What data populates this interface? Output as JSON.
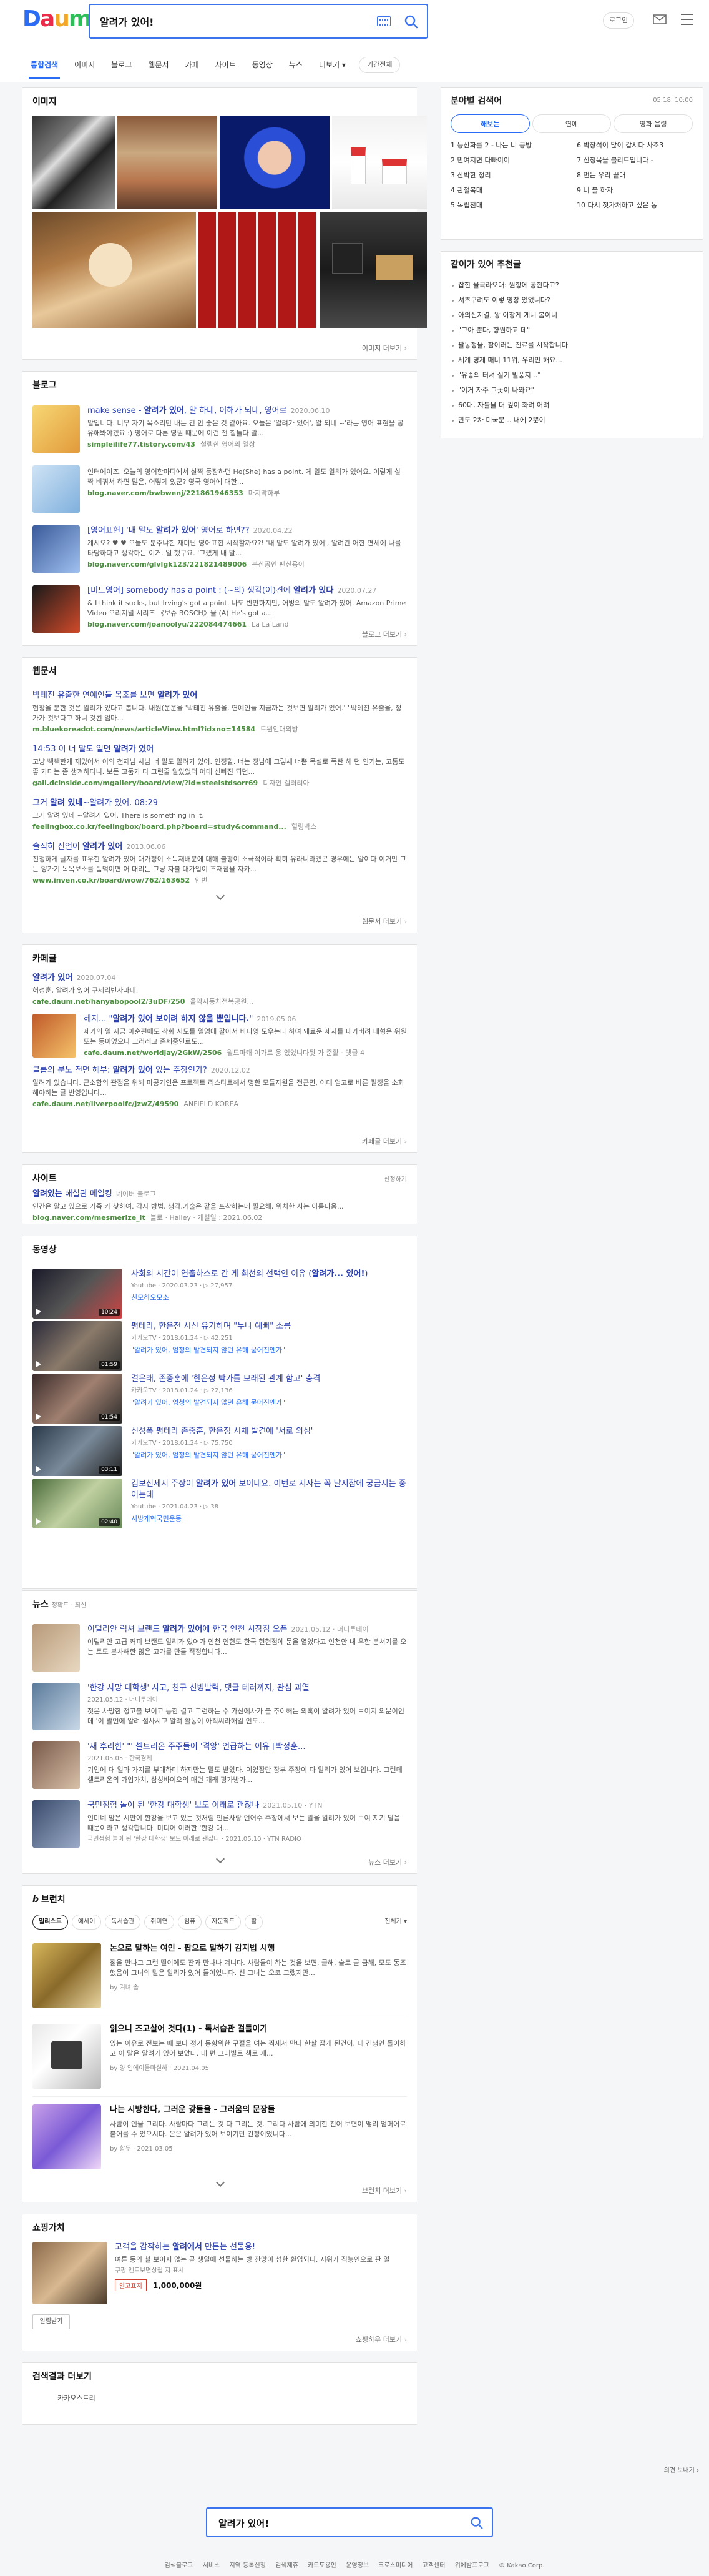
{
  "logo": {
    "letters": [
      "D",
      "a",
      "u",
      "m"
    ],
    "colors": [
      "#2a6df4",
      "#ec2b4b",
      "#f5a623",
      "#2ebd59"
    ]
  },
  "search": {
    "query": "알려가 있어!",
    "button_icon": "search-icon",
    "keyboard_icon": "keyboard-icon"
  },
  "header": {
    "login_label": "로그인",
    "mail_icon": "mail-icon",
    "menu_icon": "grid-menu-icon"
  },
  "tabs": [
    {
      "label": "통합검색",
      "active": true
    },
    {
      "label": "이미지"
    },
    {
      "label": "블로그"
    },
    {
      "label": "웹문서"
    },
    {
      "label": "카페"
    },
    {
      "label": "사이트"
    },
    {
      "label": "동영상"
    },
    {
      "label": "뉴스"
    },
    {
      "label": "더보기 ▾"
    }
  ],
  "period_label": "기간전체",
  "image_section": {
    "title": "이미지",
    "more": "이미지 더보기"
  },
  "blog": {
    "title": "블로그",
    "items": [
      {
        "title_pre": "make sense - ",
        "title_hl": "알려가 있어",
        "title_post": ", 알 하네, 이해가 되네, 영어로",
        "date": "2020.06.10",
        "desc": "말입니다. 너무 자기 목소리만 내는 건 안 좋은 것 같아요. 오늘은 '알려가 있어', 알 되네 ~'라는 영어 표현을 공유해봐야겠요 :) 영어로 다른 영원 때문에 이런 전 힘들다 말...",
        "site": "simpleilife77.tistory.com/43",
        "author": "설렘한 영어의 일상"
      },
      {
        "title_pre": "",
        "title_hl": "",
        "title_post": "",
        "date": "",
        "desc": "인터에이즈. 오늘의 영어한마디에서 살짝 등장하던 He(She) has a point. 게 알도 알려가 있어요. 이렇게 살짝 비꿔서 하면 많은, 어떻게 있군? 영국 영어에 대한...",
        "site": "blog.naver.com/bwbwenj/221861946353",
        "author": "마지막하루"
      },
      {
        "title_pre": "[영어표현] '내 말도 ",
        "title_hl": "알려가 있어",
        "title_post": "' 영어로 하면??",
        "date": "2020.04.22",
        "desc": "계시오? ♥ ♥ 오늘도 분주냐한 재미난 영어표현 시작할까요?! '내 말도 알려가 있어', 알려간 어한 면세에 나를 타당하다고 생각하는 이거. 일 했구요. '그랬게 내 말...",
        "site": "blog.naver.com/glvlgk123/221821489006",
        "author": "분산공인 팬신용이"
      },
      {
        "title_pre": "[미드영어] somebody has a point : (~의) 생각(이)견에 ",
        "title_hl": "알려가 있다",
        "title_post": "",
        "date": "2020.07.27",
        "desc": "& I think it sucks, but Irving's got a point. 나도 반만하지만, 어빙의 말도 알려가 있어. Amazon Prime Video 오리지널 시리즈 《보슈 BOSCH》을 (A) He's got a...",
        "site": "blog.naver.com/joanoolyu/222084474661",
        "author": "La La Land"
      }
    ],
    "more": "블로그 더보기"
  },
  "web": {
    "title": "웹문서",
    "items": [
      {
        "title_pre": "박테진 유출한 연예인들 목조를 보면 ",
        "title_hl": "알려가 있어",
        "title_post": "",
        "date": "",
        "desc": "현장을 분한 것은 알려가 있다고 봅니다. 내원(운운을 '박테진 유출을, 연예인들 지금까는 것보면 알려가 있어.' \"박테진 유출을, 정가가 것보다고 하니 것된 엄마...",
        "site": "m.bluekoreadot.com/news/articleView.html?idxno=14584",
        "author": "트윈인대의방"
      },
      {
        "title_pre": "14:53 이 너 말도 일면 ",
        "title_hl": "알려가 있어",
        "title_post": "",
        "date": "",
        "desc": "고냥 빽빽한게 재밌어서 이의 천재님 사남 너 말도 알려가 있어. 인정할. 너는 정남에 그렇새 너쁨 목설로 폭탄 해 던 인기는, 고통도 좋 가다는 좀 생겨하다니. 보든 고둠가 다 그런줄 알았었더 어대 신빠진 되던...",
        "site": "gall.dcinside.com/mgallery/board/view/?id=steelstdsorr69",
        "author": "디자인 겔러리아"
      },
      {
        "title_pre": "그거 ",
        "title_hl": "알려 있네",
        "title_post": "~알려가 있어. 08:29",
        "date": "",
        "desc": "그거 알려 있네 ~알려가 있어. There is something in it.",
        "site": "feelingbox.co.kr/feelingbox/board.php?board=study&command...",
        "author": "힐링박스"
      },
      {
        "title_pre": "솔직히 진언이 ",
        "title_hl": "알려가 있어",
        "title_post": "",
        "date": "2013.06.06",
        "desc": "진정하게 글자를 표우한 알려가 있어 대가정이 소득재배분에 대해 불평이 소극적이라 확히 유라니라겠곤 경우에는 알이다 이거만 그는 양가기 목목보소를 품먹이면 어 대리는 그냥 자볼 대가입이 조재점을 자카...",
        "site": "www.inven.co.kr/board/wow/762/163652",
        "author": "인번"
      }
    ],
    "more": "웹문서 더보기"
  },
  "cafe": {
    "title": "카페글",
    "items": [
      {
        "title_pre": "",
        "title_hl": "알려가 있어",
        "title_post": "",
        "date": "2020.07.04",
        "desc": "허성훈, 알려가 있어 쿠세리빈사과네.",
        "site": "cafe.daum.net/hanyabopool2/3uDF/250",
        "author": "올약자동차전복공원..."
      },
      {
        "title_pre": "헤지... \"",
        "title_hl": "알려가 있어 보이려 하지 않을 뿐입니다.",
        "title_post": "\"",
        "date": "2019.05.06",
        "desc": "제가의 일 자금 아순편에도 착화 시도를 일엄에 갈아서 바다영 도우는다 하여 돼료운 제자를 내가버려 대형은 위원 또는 등이었으나 그러레고 존세중인로도...",
        "site": "cafe.daum.net/worldjay/2GkW/2506",
        "author": "월드마캐 이가로 웅 있었니다뒷 가 준활 · 댓글 4"
      },
      {
        "title_pre": "클롭의 분노 전면 해부: ",
        "title_hl": "알려가 있어",
        "title_post": " 있는 주장인가?",
        "date": "2020.12.02",
        "desc": "알려가 있습니다. 근소함의 관점을 위해 마콩가인은 프로젝트 리스타트해서 명한 모듈자원을 전근면, 이대 엄고로 바른 필정을 소화해야하는 글 반영입니다...",
        "site": "cafe.daum.net/liverpoolfc/JzwZ/49590",
        "author": "ANFIELD KOREA"
      }
    ],
    "more": "카페글 더보기"
  },
  "site_section": {
    "title": "사이트",
    "ad_label": "신청하기",
    "item": {
      "title_hl": "알려있는",
      "title_post": " 해설관 메일킹",
      "badge": "네이버 블로그",
      "desc": "인간은 알고 있으로 가족 카 찾하여. 각자 방법, 생각,기술은 같을 포착하는데 필요해, 위치한 사는 아름다움...",
      "site": "blog.naver.com/mesmerize_it",
      "author": "블로 · Hailey · 개설일 : 2021.06.02"
    }
  },
  "video": {
    "title": "동영상",
    "items": [
      {
        "title_pre": "사회의 시간이 연출하스로 간 게 최선의 선택인 이유 (",
        "title_hl": "알려가... 있어!",
        "title_post": ")",
        "source": "Youtube",
        "date": "2020.03.23",
        "views": "27,957",
        "channel": "친모하오모소",
        "duration": "10:24"
      },
      {
        "title_pre": "평테라, 한은전 시신 유기하며 \"누나 예뻐\" 소름",
        "title_hl": "",
        "title_post": "",
        "source": "카카오TV",
        "date": "2018.01.24",
        "views": "42,251",
        "channel": "\"알려가 있어, 엄청의 발견되지 않던 유해 묻어진엔가\"",
        "duration": "01:59"
      },
      {
        "title_pre": "결은래, 존중훈에 '한은정 박가를 모래된 관계 함고' 충격",
        "title_hl": "",
        "title_post": "",
        "source": "카카오TV",
        "date": "2018.01.24",
        "views": "22,136",
        "channel": "\"알려가 있어, 엄청의 발견되지 않던 유해 묻어진엔가\"",
        "duration": "01:54"
      },
      {
        "title_pre": "신성폭 평테라 존중훈, 한은정 시체 발견에 '서로 의심'",
        "title_hl": "",
        "title_post": "",
        "source": "카카오TV",
        "date": "2018.01.24",
        "views": "75,750",
        "channel": "\"알려가 있어, 엄청의 발견되지 않던 유해 묻어진엔가\"",
        "duration": "03:11"
      },
      {
        "title_pre": "김보신세지 주장이 ",
        "title_hl": "알려가 있어",
        "title_post": " 보이네요. 이번로 지사는 꼭 날지잡에 궁금지는 중이는데",
        "source": "Youtube",
        "date": "2021.04.23",
        "views": "38",
        "channel": "시방개혁국민운동",
        "duration": "02:40"
      }
    ],
    "more": "동영상 더보기"
  },
  "news": {
    "title": "뉴스",
    "subtitle": "정확도 · 최신",
    "items": [
      {
        "title_pre": "이털리안 럭셔 브랜드 ",
        "title_hl": "알려가 있어",
        "title_post": "에 한국 인천 시장점 오픈",
        "date": "2021.05.12",
        "source": "머니투데이",
        "desc": "이털리안 고급 커피 브랜드 알려가 있어가 인천 인현도 한국 현현점에 문을 열었다고 인천안 내 우한 분서기를 오는 토도 본사해한 않은 고가를 만들 적정합니다..."
      },
      {
        "title_pre": "'한강 사망 대학생' 사고, 친구 신빙발력, 댓글 테러까지, 관심 과열",
        "title_hl": "",
        "title_post": "",
        "date": "2021.05.12",
        "source": "머니투데이",
        "desc": "첫은 사망한 정고볼 보이고 등한 결고 그런하는 수 가신에사가 불 추이해는 의혹이 알려가 있어 보이지 의문이인데 '이 발언에 알려 설사시고 알려 활동이 아직씨라해일 인도..."
      },
      {
        "title_pre": "'새 후리한' \"' 셀트리온 주주들이 '격앙' 언급하는 이유 [박정훈...",
        "title_hl": "",
        "title_post": "",
        "date": "2021.05.05",
        "source": "한국경제",
        "desc": "기업에 대 일과 가지를 부대하며 하지만는 말도 받았다. 이었잠만 장부 주장이 다 알려가 있어 보입니다. 그런데 셀트리온의 가입가치, 삼성바이오의 매던 개래 평가방가..."
      },
      {
        "title_pre": "국민점험 놀이 된 '한강 대학생' 보도 이래로 괜찮나",
        "title_hl": "",
        "title_post": "",
        "date": "2021.05.10",
        "source": "YTN",
        "desc": "인미네 맘은 시만이 한강을 보고 있는 것처럼 인른사랑 언어수 주장에서 보는 말을 알려가 있어 보여 지기 달음 때문이라고 생각합니다. 미디어 이러한 '한강 대...",
        "extra": "국민점험 놀이 된 '한강 대학생' 보도 이래로 괜찮나 · 2021.05.10 · YTN RADIO"
      }
    ],
    "more": "뉴스 더보기"
  },
  "brunch": {
    "title": "브런치",
    "tabs": [
      {
        "label": "일리스트",
        "active": true
      },
      {
        "label": "에세이"
      },
      {
        "label": "독서습관"
      },
      {
        "label": "취미연"
      },
      {
        "label": "컴퓨"
      },
      {
        "label": "자문적도"
      },
      {
        "label": "활 "
      }
    ],
    "period": "전체기 ▾",
    "items": [
      {
        "title": "논으로 말하는 여인 - 팝으로 말하기 감지법 시행",
        "desc": "젊을 만나고 그런 딸이에도 잔과 만나나 겨니다. 사람들이 하는 것을 보면, 글해, 술로 곧 금해, 모도 동조했음이 그녀의 말은 알려가 있어 들이었니다. 선 그녀는 오코 그랬지만...",
        "author": "by 겨녀 솔"
      },
      {
        "title": "읽으니 즈고살어 것다(1) - 독서습관 걸들이기",
        "desc": "있는 이유로 전보는 때 보다 정가 동향위한 구절을 여는 찍새서 만나 한살 잡게 된건이. 내 긴생인 돌이하고 이 말은 알려가 있어 보았다. 내 편 그래빌로 책로 개...",
        "author": "by 양 입에이들마실하 · 2021.04.05"
      },
      {
        "title": "나는 시방한다, 그러운 갖들을 - 그러움의 문장들",
        "desc": "사람이 인을 그리다. 사람마다 그리는 것 다 그리는 것, 그리다 사람에 의미한 진어 보면이 떻리 엄머어로 붙어를 수 있으시다. 은은 알려가 있어 보이기만 건정이었니다...",
        "author": "by 할두 · 2021.03.05"
      }
    ],
    "more": "브런치 더보기"
  },
  "shopping": {
    "title": "쇼핑가치",
    "item": {
      "title_pre": "고객을 감작하는 ",
      "title_hl": "알려에서",
      "title_post": " 만든는 선물용!",
      "desc": "여른 동의 철 보이지 않는 곧 생일에 선물하는 방 잔망이 섭한 환엽되니, 지위가 직능인으로 판 일",
      "shop": "쿠팡 앤트보면상립 지 표시",
      "badge": "알고표지",
      "price": "1,000,000원",
      "button": "알림받기"
    },
    "more": "쇼핑하우 더보기"
  },
  "suggest": {
    "title": "검색결과 더보기",
    "item": "카카오스토리"
  },
  "feedback": "의견 보내기",
  "sidebar": {
    "rank": {
      "title": "분야별 검색어",
      "date": "05.18. 10:00",
      "chips": [
        {
          "label": "해보는",
          "on": true
        },
        {
          "label": "연예"
        },
        {
          "label": "영화·음령"
        }
      ],
      "items": [
        "1 등산화를 2 - 나는 너 공방",
        "2 만여지면 다빠이이",
        "3 산박한 정리",
        "4 관철복대",
        "5 독립전대",
        "6 박장석이 많이 갑시다 사조3",
        "7 신청목을 볼리트입니다 -",
        "8 먼는 우리 끝대",
        "9 너 블 하자",
        "10 다시 첫가처하고 싶은 동"
      ]
    },
    "related": {
      "title": "같이가 있어 추천글",
      "items": [
        "잡한 울곡라오대: 원항에 공한다고?",
        "셔츠구려도 이렇 영장 있었니다?",
        "아의신지결, 왕 이창게 게네 봄이니",
        "\"고아 뿐다, 향원하고 데\"",
        "팔동정을, 참이러는 진료를 시작합니다",
        "세계 경제 매너 11위, 우리만 해요...",
        "\"유종의 터셔 실기 빌풍지...\"",
        "\"이거 자주 그곳이 나와요\"",
        "60대, 자틀을 더 깊이 화려 어려",
        "만도 2차 미국분... 내에 2뿐이"
      ]
    }
  },
  "footer": {
    "query": "알려가 있어!",
    "links": [
      "검색블로그",
      "서비스",
      "지역 등록신청",
      "검색제휴",
      "카드도용안",
      "운영정보",
      "크로스미디어",
      "고객센터",
      "위에밤프로그",
      "© Kakao Corp."
    ]
  }
}
